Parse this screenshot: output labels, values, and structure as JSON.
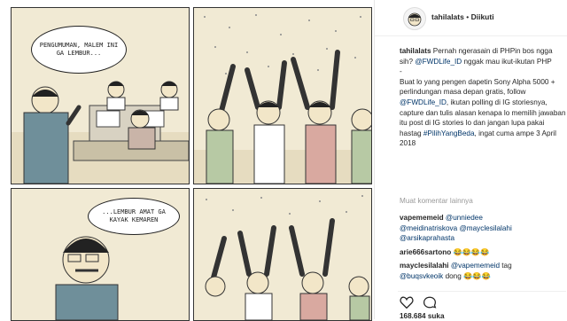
{
  "comic": {
    "panel1_text": "PENGUMUMAN, MALEM INI GA LEMBUR...",
    "panel3_text": "...LEMBUR AMAT GA KAYAK KEMAREN"
  },
  "post": {
    "username": "tahilalats",
    "dot": "•",
    "follow_status": "Diikuti"
  },
  "caption": {
    "username": "tahilalats",
    "line1": "Pernah ngerasain di PHPin bos ngga sih?",
    "mention1": "@FWDLife_ID",
    "line2": "nggak mau ikut-ikutan PHP",
    "dash": "-",
    "line3": "Buat lo yang pengen dapetin Sony Alpha 5000 + perlindungan masa depan gratis, follow",
    "mention2": "@FWDLife_ID",
    "line4": ", ikutan polling di IG storiesnya, capture dan tulis alasan kenapa lo memilih jawaban itu post di IG stories lo dan jangan lupa pakai hastag",
    "hashtag": "#PilihYangBeda",
    "line5": ", ingat cuma ampe 3 April 2018"
  },
  "load_more": "Muat komentar lainnya",
  "comments": [
    {
      "user": "vapememeid",
      "parts": [
        "@unniedee",
        "@meidinatriskova",
        "@mayclesilalahi",
        "@arsikaprahasta"
      ]
    },
    {
      "user": "arie666sartono",
      "text": "😂😂😂😂"
    },
    {
      "user": "mayclesilalahi",
      "mention": "@vapememeid",
      "text": "tag",
      "mention2": "@buqsvkeoik",
      "text2": "dong 😂😂😂"
    }
  ],
  "actions": {
    "like_icon": "heart-icon",
    "comment_icon": "comment-icon"
  },
  "likes": "168.684 suka"
}
